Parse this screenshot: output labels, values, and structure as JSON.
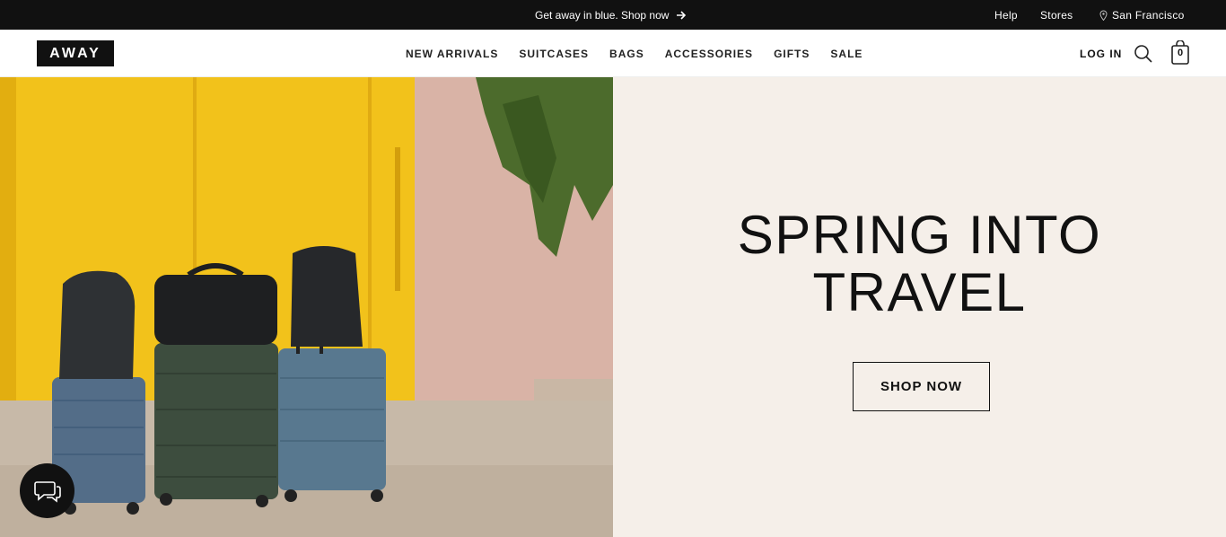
{
  "announcement": {
    "text": "Get away in blue. Shop now",
    "arrow_icon": "arrow-right-icon"
  },
  "utility": {
    "help": "Help",
    "stores": "Stores",
    "location": "San Francisco",
    "location_icon": "map-pin-icon"
  },
  "header": {
    "logo": "AWAY",
    "nav": [
      "NEW ARRIVALS",
      "SUITCASES",
      "BAGS",
      "ACCESSORIES",
      "GIFTS",
      "SALE"
    ],
    "login": "LOG IN",
    "search_icon": "search-icon",
    "cart_icon": "shopping-bag-icon",
    "cart_count": "0"
  },
  "hero": {
    "headline_line1": "SPRING INTO",
    "headline_line2": "TRAVEL",
    "cta": "SHOP NOW",
    "panel_color": "#f5efe9"
  },
  "chat": {
    "icon": "chat-bubbles-icon"
  },
  "colors": {
    "topbar": "#111111",
    "yellow_wall": "#f2c21b",
    "pink_wall": "#d9b3a6"
  }
}
